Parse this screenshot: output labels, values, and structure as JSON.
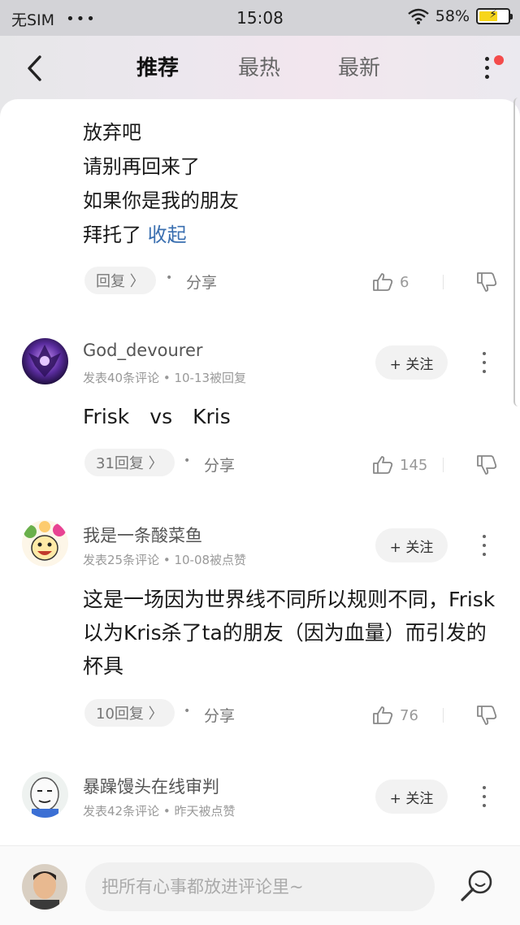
{
  "status_bar": {
    "carrier": "无SIM",
    "signal_dots": "•••",
    "time": "15:08",
    "battery": "58%"
  },
  "nav": {
    "tabs": [
      "推荐",
      "最热",
      "最新"
    ],
    "active_tab": "推荐"
  },
  "expanded_reply": {
    "lines": [
      "放弃吧",
      "请别再回来了",
      "如果你是我的朋友",
      "拜托了"
    ],
    "collapse_label": "收起",
    "reply_label": "回复 〉",
    "share_label": "分享",
    "likes": "6"
  },
  "comments": [
    {
      "username": "God_devourer",
      "meta": "发表40条评论 • 10-13被回复",
      "follow_label": "+ 关注",
      "text": "Frisk　vs　Kris",
      "replies_label": "31回复 〉",
      "share_label": "分享",
      "likes": "145"
    },
    {
      "username": "我是一条酸菜鱼",
      "meta": "发表25条评论 • 10-08被点赞",
      "follow_label": "+ 关注",
      "text": "这是一场因为世界线不同所以规则不同，Frisk以为Kris杀了ta的朋友（因为血量）而引发的杯具",
      "replies_label": "10回复 〉",
      "share_label": "分享",
      "likes": "76"
    },
    {
      "username": "暴躁馒头在线审判",
      "meta": "发表42条评论 • 昨天被点赞",
      "follow_label": "+ 关注"
    }
  ],
  "bottom_bar": {
    "placeholder": "把所有心事都放进评论里~"
  },
  "colors": {
    "accent_link": "#3a6fb0",
    "notification_dot": "#f44b4b",
    "battery_fill": "#f7d51b"
  },
  "icons": [
    "back-arrow-icon",
    "more-vertical-icon",
    "thumbs-up-icon",
    "thumbs-down-icon",
    "emoji-search-icon",
    "wifi-icon",
    "battery-icon"
  ]
}
